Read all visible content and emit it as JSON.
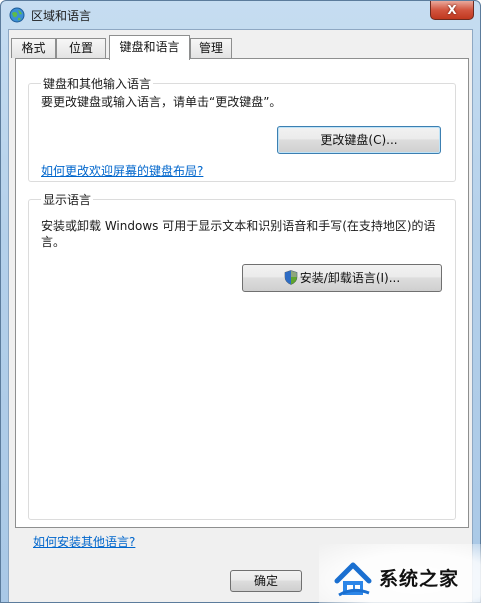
{
  "window": {
    "title": "区域和语言",
    "close_label": "X"
  },
  "tabs": [
    {
      "label": "格式",
      "active": false
    },
    {
      "label": "位置",
      "active": false
    },
    {
      "label": "键盘和语言",
      "active": true
    },
    {
      "label": "管理",
      "active": false
    }
  ],
  "keyboard_group": {
    "title": "键盘和其他输入语言",
    "description": "要更改键盘或输入语言，请单击“更改键盘”。",
    "change_button": "更改键盘(C)...",
    "welcome_link": "如何更改欢迎屏幕的键盘布局?"
  },
  "display_group": {
    "title": "显示语言",
    "description_line1": "安装或卸载 Windows 可用于显示文本和识别语音和手写(在支持地区)的语",
    "description_line2": "言。",
    "install_button": "安装/卸载语言(I)..."
  },
  "footer": {
    "install_link": "如何安装其他语言?",
    "ok_button": "确定"
  },
  "watermark": {
    "text": "系统之家"
  },
  "colors": {
    "link": "#0066cc",
    "close": "#c0381f",
    "title_bar": "#b4d0ea"
  }
}
